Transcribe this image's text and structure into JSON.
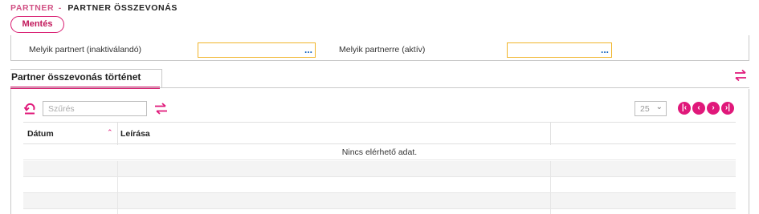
{
  "breadcrumb": {
    "parent": "PARTNER",
    "separator": "-",
    "current": "PARTNER ÖSSZEVONÁS"
  },
  "toolbar": {
    "save_label": "Mentés"
  },
  "form": {
    "inactive_label": "Melyik partnert (inaktiválandó)",
    "inactive_value": "",
    "active_label": "Melyik partnerre (aktív)",
    "active_value": "",
    "lookup_dots": "..."
  },
  "tab": {
    "label": "Partner összevonás történet"
  },
  "grid": {
    "filter_placeholder": "Szűrés",
    "page_size": "25",
    "columns": [
      "Dátum",
      "Leírása",
      ""
    ],
    "empty_message": "Nincs elérhető adat.",
    "rows": []
  },
  "icons": {
    "reset": "undo-icon",
    "swap": "swap-arrows-icon",
    "first": "first-page-icon",
    "prev": "prev-page-icon",
    "next": "next-page-icon",
    "last": "last-page-icon"
  },
  "colors": {
    "accent": "#e0187a",
    "lookup_border": "#f0b429",
    "dots": "#1565c0"
  }
}
